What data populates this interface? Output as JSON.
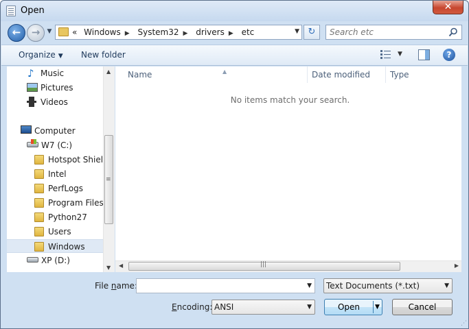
{
  "window": {
    "title": "Open",
    "close_glyph": "✕"
  },
  "nav": {
    "back_glyph": "←",
    "forward_glyph": "→",
    "breadcrumb_overflow": "«",
    "breadcrumb": [
      "Windows",
      "System32",
      "drivers",
      "etc"
    ],
    "search_placeholder": "Search etc"
  },
  "toolbar": {
    "organize_label": "Organize",
    "new_folder_label": "New folder",
    "help_glyph": "?"
  },
  "navpane": {
    "items": [
      {
        "label": "Music",
        "icon": "music-icon"
      },
      {
        "label": "Pictures",
        "icon": "pictures-icon"
      },
      {
        "label": "Videos",
        "icon": "videos-icon"
      },
      {
        "label": "Computer",
        "icon": "computer-icon"
      },
      {
        "label": "W7 (C:)",
        "icon": "drive-icon"
      },
      {
        "label": "Hotspot Shield",
        "icon": "folder-icon"
      },
      {
        "label": "Intel",
        "icon": "folder-icon"
      },
      {
        "label": "PerfLogs",
        "icon": "folder-icon"
      },
      {
        "label": "Program Files",
        "icon": "folder-icon"
      },
      {
        "label": "Python27",
        "icon": "folder-icon"
      },
      {
        "label": "Users",
        "icon": "folder-icon"
      },
      {
        "label": "Windows",
        "icon": "folder-icon",
        "selected": true
      },
      {
        "label": "XP (D:)",
        "icon": "drive-icon"
      }
    ]
  },
  "filelist": {
    "columns": [
      "Name",
      "Date modified",
      "Type"
    ],
    "empty_message": "No items match your search."
  },
  "footer": {
    "filename_label_prefix": "File ",
    "filename_label_key": "n",
    "filename_label_suffix": "ame:",
    "filename_value": "",
    "filetype_value": "Text Documents (*.txt)",
    "encoding_label_key": "E",
    "encoding_label_suffix": "ncoding:",
    "encoding_value": "ANSI",
    "open_label": "Open",
    "cancel_label": "Cancel"
  },
  "colors": {
    "window_bg": "#cfe0f2",
    "selected_row": "#dfe9f5",
    "accent": "#3c7fb1"
  }
}
